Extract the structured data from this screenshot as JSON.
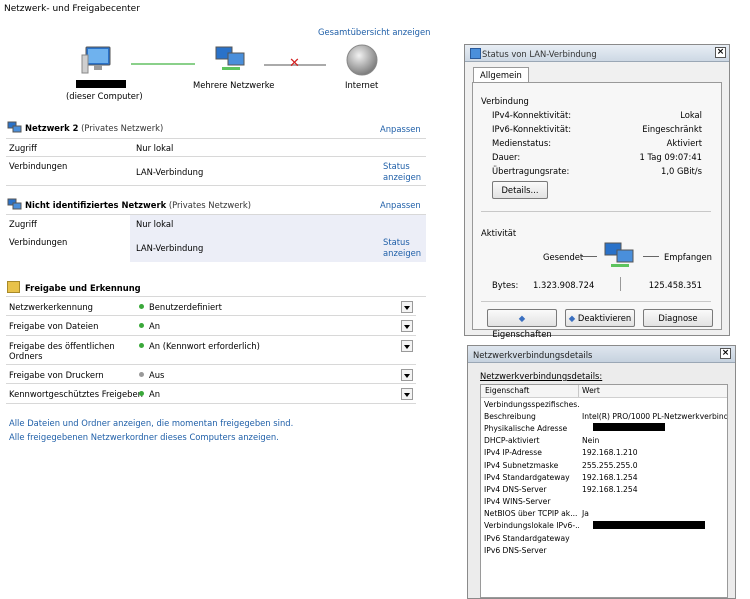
{
  "page": {
    "title": "Netzwerk- und Freigabecenter",
    "overview_link": "Gesamtübersicht anzeigen"
  },
  "map": {
    "computer_label": "(dieser Computer)",
    "multi_label": "Mehrere Netzwerke",
    "internet_label": "Internet"
  },
  "network1": {
    "name": "Netzwerk  2",
    "type": "(Privates Netzwerk)",
    "customize": "Anpassen",
    "rows": [
      {
        "label": "Zugriff",
        "value": "Nur lokal"
      },
      {
        "label": "Verbindungen",
        "value": "LAN-Verbindung",
        "action1": "Status",
        "action2": "anzeigen"
      }
    ]
  },
  "network2": {
    "name": "Nicht identifiziertes Netzwerk",
    "type": "(Privates Netzwerk)",
    "customize": "Anpassen",
    "rows": [
      {
        "label": "Zugriff",
        "value": "Nur lokal"
      },
      {
        "label": "Verbindungen",
        "value": "LAN-Verbindung",
        "action1": "Status",
        "action2": "anzeigen"
      }
    ]
  },
  "sharing": {
    "title": "Freigabe und Erkennung",
    "rows": [
      {
        "label": "Netzwerkerkennung",
        "value": "Benutzerdefiniert",
        "status": "on"
      },
      {
        "label": "Freigabe von Dateien",
        "value": "An",
        "status": "on"
      },
      {
        "label": "Freigabe des öffentlichen",
        "label2": "Ordners",
        "value": "An (Kennwort erforderlich)",
        "status": "on"
      },
      {
        "label": "Freigabe von Druckern",
        "value": "Aus",
        "status": "off"
      },
      {
        "label": "Kennwortgeschütztes Freigeben",
        "value": "An",
        "status": "on"
      }
    ],
    "link1": "Alle Dateien und Ordner anzeigen, die momentan freigegeben sind.",
    "link2": "Alle freigegebenen Netzwerkordner dieses Computers anzeigen."
  },
  "status_dialog": {
    "title": "Status von LAN-Verbindung",
    "close": "×",
    "tab": "Allgemein",
    "group_connection": "Verbindung",
    "rows": [
      {
        "label": "IPv4-Konnektivität:",
        "value": "Lokal"
      },
      {
        "label": "IPv6-Konnektivität:",
        "value": "Eingeschränkt"
      },
      {
        "label": "Medienstatus:",
        "value": "Aktiviert"
      },
      {
        "label": "Dauer:",
        "value": "1 Tag 09:07:41"
      },
      {
        "label": "Übertragungsrate:",
        "value": "1,0 GBit/s"
      }
    ],
    "details_button": "Details...",
    "group_activity": "Aktivität",
    "sent_label": "Gesendet",
    "received_label": "Empfangen",
    "bytes_label": "Bytes:",
    "bytes_sent": "1.323.908.724",
    "bytes_received": "125.458.351",
    "btn_properties": "Eigenschaften",
    "btn_disable": "Deaktivieren",
    "btn_diagnose": "Diagnose"
  },
  "details_dialog": {
    "title": "Netzwerkverbindungsdetails",
    "close": "×",
    "caption": "Netzwerkverbindungsdetails:",
    "col_property": "Eigenschaft",
    "col_value": "Wert",
    "rows": [
      {
        "p": "Verbindungsspezifisches...",
        "v": ""
      },
      {
        "p": "Beschreibung",
        "v": "Intel(R) PRO/1000 PL-Netzwerkverbindu..."
      },
      {
        "p": "Physikalische Adresse",
        "v": ""
      },
      {
        "p": "DHCP-aktiviert",
        "v": "Nein"
      },
      {
        "p": "IPv4 IP-Adresse",
        "v": "192.168.1.210"
      },
      {
        "p": "IPv4 Subnetzmaske",
        "v": "255.255.255.0"
      },
      {
        "p": "IPv4 Standardgateway",
        "v": "192.168.1.254"
      },
      {
        "p": "IPv4 DNS-Server",
        "v": "192.168.1.254"
      },
      {
        "p": "IPv4 WINS-Server",
        "v": ""
      },
      {
        "p": "NetBIOS über TCPIP ak...",
        "v": "Ja"
      },
      {
        "p": "Verbindungslokale IPv6-...",
        "v": ""
      },
      {
        "p": "IPv6 Standardgateway",
        "v": ""
      },
      {
        "p": "IPv6 DNS-Server",
        "v": ""
      }
    ]
  },
  "colors": {
    "link": "#1f5fa8",
    "status_on": "#3aa83a",
    "status_off": "#999999",
    "x_red": "#d22020"
  }
}
